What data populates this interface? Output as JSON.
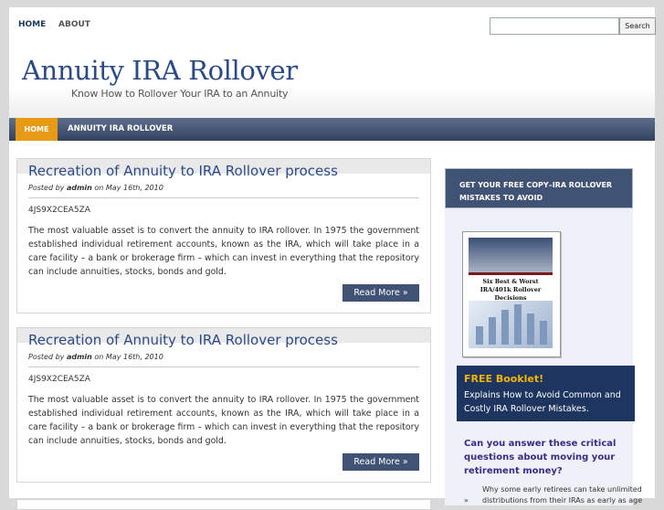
{
  "topnav": {
    "links": [
      "HOME",
      "ABOUT"
    ],
    "search_placeholder": "",
    "search_button": "Search"
  },
  "header": {
    "title": "Annuity IRA Rollover",
    "tagline": "Know How to Rollover Your IRA to an Annuity"
  },
  "mainnav": {
    "home": "HOME",
    "item": "ANNUITY IRA ROLLOVER"
  },
  "posts": [
    {
      "title": "Recreation of Annuity to IRA Rollover process",
      "posted_by": "Posted by",
      "author": "admin",
      "date": "on May 16th, 2010",
      "code": "4JS9X2CEA5ZA",
      "body": "The most valuable asset is to convert the annuity to IRA rollover. In 1975 the government established individual retirement accounts, known as the IRA, which will take place in a care facility – a bank or brokerage firm – which can invest in everything that the repository can include annuities, stocks, bonds and gold.",
      "more": "Read More »"
    },
    {
      "title": "Recreation of Annuity to IRA Rollover process",
      "posted_by": "Posted by",
      "author": "admin",
      "date": "on May 16th, 2010",
      "code": "4JS9X2CEA5ZA",
      "body": "The most valuable asset is to convert the annuity to IRA rollover. In 1975 the government established individual retirement accounts, known as the IRA, which will take place in a care facility – a bank or brokerage firm – which can invest in everything that the repository can include annuities, stocks, bonds and gold.",
      "more": "Read More »"
    }
  ],
  "sidebar": {
    "heading": "GET YOUR FREE COPY–IRA ROLLOVER MISTAKES TO AVOID",
    "cover_title": "Six Best & Worst IRA/401k Rollover Decisions",
    "free_title": "FREE Booklet!",
    "free_text": "Explains How to Avoid Common and Costly IRA Rollover Mistakes.",
    "question": "Can you answer these critical questions about moving your retirement money?",
    "bullet_text": "Why some early retirees can take unlimited distributions from their IRAs as early as age",
    "bullet_arrow": "»"
  },
  "colors": {
    "accent": "#e79b14",
    "nav": "#415374",
    "title": "#2c4a86"
  }
}
